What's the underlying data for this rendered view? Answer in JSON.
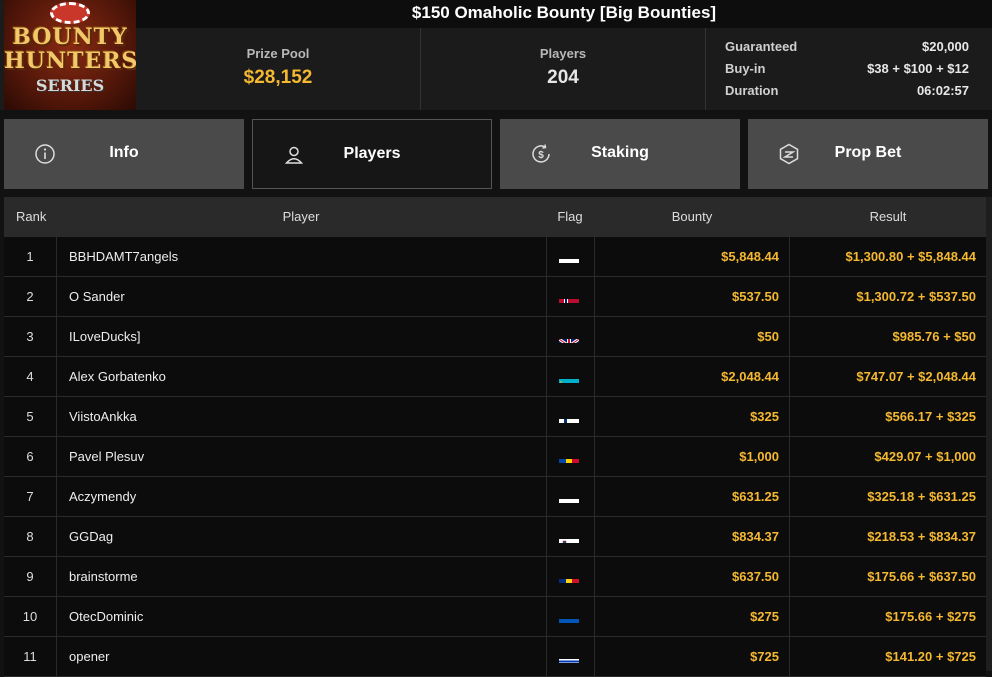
{
  "logo": {
    "line1": "BOUNTY",
    "line2": "HUNTERS",
    "line3": "SERIES"
  },
  "title": "$150 Omaholic Bounty [Big Bounties]",
  "prize_pool": {
    "label": "Prize Pool",
    "value": "$28,152"
  },
  "players_stat": {
    "label": "Players",
    "value": "204"
  },
  "details": [
    {
      "key": "Guaranteed",
      "value": "$20,000"
    },
    {
      "key": "Buy-in",
      "value": "$38 + $100 + $12"
    },
    {
      "key": "Duration",
      "value": "06:02:57"
    }
  ],
  "tabs": [
    {
      "label": "Info",
      "icon": "info-icon",
      "active": false
    },
    {
      "label": "Players",
      "icon": "user-icon",
      "active": true
    },
    {
      "label": "Staking",
      "icon": "dollar-cycle-icon",
      "active": false
    },
    {
      "label": "Prop Bet",
      "icon": "prop-bet-icon",
      "active": false
    }
  ],
  "columns": {
    "rank": "Rank",
    "player": "Player",
    "flag": "Flag",
    "bounty": "Bounty",
    "result": "Result"
  },
  "rows": [
    {
      "rank": "1",
      "player": "BBHDAMT7angels",
      "flag": "cyprus-flag",
      "bounty": "$5,848.44",
      "result": "$1,300.80 + $5,848.44"
    },
    {
      "rank": "2",
      "player": "O Sander",
      "flag": "norway-flag",
      "bounty": "$537.50",
      "result": "$1,300.72 + $537.50"
    },
    {
      "rank": "3",
      "player": "ILoveDucks]",
      "flag": "uk-flag",
      "bounty": "$50",
      "result": "$985.76 + $50"
    },
    {
      "rank": "4",
      "player": "Alex Gorbatenko",
      "flag": "kazakhstan-flag",
      "bounty": "$2,048.44",
      "result": "$747.07 + $2,048.44"
    },
    {
      "rank": "5",
      "player": "ViistoAnkka",
      "flag": "finland-flag",
      "bounty": "$325",
      "result": "$566.17 + $325"
    },
    {
      "rank": "6",
      "player": "Pavel Plesuv",
      "flag": "moldova-flag",
      "bounty": "$1,000",
      "result": "$429.07 + $1,000"
    },
    {
      "rank": "7",
      "player": "Aczymendy",
      "flag": "cyprus-flag",
      "bounty": "$631.25",
      "result": "$325.18 + $631.25"
    },
    {
      "rank": "8",
      "player": "GGDag",
      "flag": "slovenia-flag",
      "bounty": "$834.37",
      "result": "$218.53 + $834.37"
    },
    {
      "rank": "9",
      "player": "brainstorme",
      "flag": "romania-flag",
      "bounty": "$637.50",
      "result": "$175.66 + $637.50"
    },
    {
      "rank": "10",
      "player": "OtecDominic",
      "flag": "ukraine-flag",
      "bounty": "$275",
      "result": "$175.66 + $275"
    },
    {
      "rank": "11",
      "player": "opener",
      "flag": "israel-flag",
      "bounty": "$725",
      "result": "$141.20 + $725"
    }
  ],
  "colors": {
    "accent": "#f5b831",
    "tab_bg": "#4a4a4a",
    "active_tab_bg": "#161616"
  }
}
